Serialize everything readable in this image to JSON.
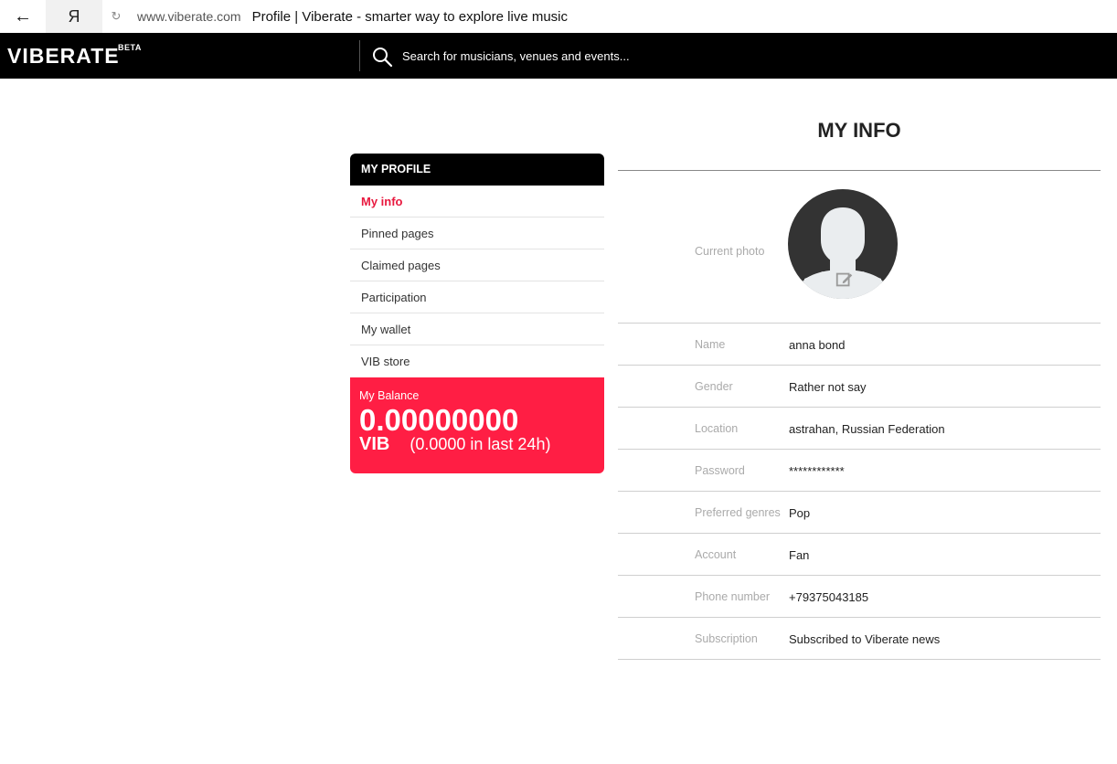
{
  "browser": {
    "back_icon": "←",
    "yandex_icon": "Я",
    "reload_icon": "↻",
    "domain": "www.viberate.com",
    "title": "Profile | Viberate - smarter way to explore live music"
  },
  "header": {
    "logo": "VIBERATE",
    "beta": "BETA",
    "search_placeholder": "Search for musicians, venues and events..."
  },
  "sidebar": {
    "heading": "MY PROFILE",
    "items": [
      {
        "label": "My info"
      },
      {
        "label": "Pinned pages"
      },
      {
        "label": "Claimed pages"
      },
      {
        "label": "Participation"
      },
      {
        "label": "My wallet"
      },
      {
        "label": "VIB store"
      }
    ],
    "active_index": 0
  },
  "balance": {
    "label": "My Balance",
    "value": "0.00000000",
    "unit": "VIB",
    "change": "(0.0000 in last 24h)"
  },
  "info": {
    "title": "MY INFO",
    "photo_label": "Current photo",
    "rows": [
      {
        "label": "Name",
        "value": "anna bond"
      },
      {
        "label": "Gender",
        "value": "Rather not say"
      },
      {
        "label": "Location",
        "value": "astrahan, Russian Federation"
      },
      {
        "label": "Password",
        "value": "************"
      },
      {
        "label": "Preferred genres",
        "value": "Pop"
      },
      {
        "label": "Account",
        "value": "Fan"
      },
      {
        "label": "Phone number",
        "value": "+79375043185"
      },
      {
        "label": "Subscription",
        "value": "Subscribed to Viberate news"
      }
    ]
  },
  "colors": {
    "accent": "#ff1e44",
    "active_text": "#e8193f",
    "header_bg": "#000000"
  }
}
